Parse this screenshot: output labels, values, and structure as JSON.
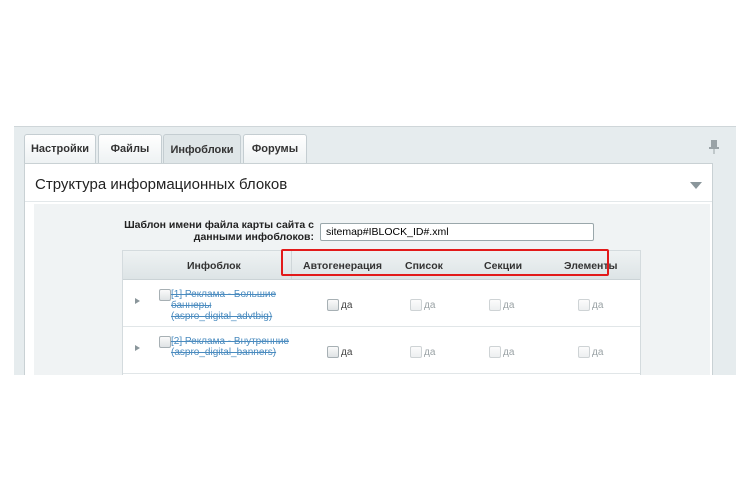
{
  "tabs": [
    "Настройки",
    "Файлы",
    "Инфоблоки",
    "Форумы"
  ],
  "active_tab": "Инфоблоки",
  "section": {
    "title": "Структура информационных блоков"
  },
  "filename_field": {
    "label": "Шаблон имени файла карты сайта с данными инфоблоков:",
    "value": "sitemap#IBLOCK_ID#.xml"
  },
  "grid": {
    "columns": [
      "Инфоблок",
      "Автогенерация",
      "Список",
      "Секции",
      "Элементы"
    ],
    "checkbox_label": "да",
    "rows": [
      {
        "name": "[1] Реклама - Большие баннеры (aspro_digital_advtbig)"
      },
      {
        "name": "[2] Реклама - Внутренние (aspro_digital_banners)"
      }
    ]
  },
  "colors": {
    "highlight": "#e21a1a",
    "link": "#4a8bbf",
    "panel_bg": "#e6ecee"
  }
}
